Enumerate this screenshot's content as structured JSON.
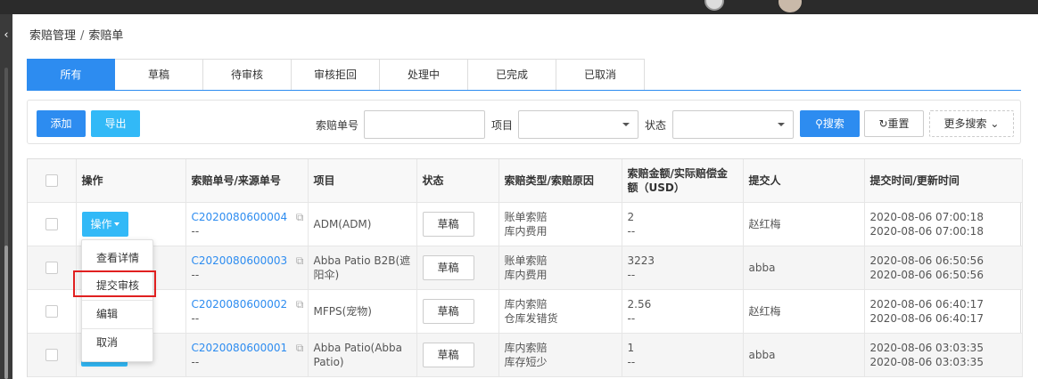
{
  "breadcrumb": {
    "parent": "索赔管理",
    "separator": "/",
    "current": "索赔单"
  },
  "tabs": [
    {
      "label": "所有",
      "active": true
    },
    {
      "label": "草稿",
      "active": false
    },
    {
      "label": "待审核",
      "active": false
    },
    {
      "label": "审核拒回",
      "active": false
    },
    {
      "label": "处理中",
      "active": false
    },
    {
      "label": "已完成",
      "active": false
    },
    {
      "label": "已取消",
      "active": false
    }
  ],
  "toolbar": {
    "add_label": "添加",
    "export_label": "导出",
    "claim_no_label": "索赔单号",
    "claim_no_value": "",
    "project_label": "项目",
    "project_value": "",
    "status_label": "状态",
    "status_value": "",
    "search_label": "搜索",
    "reset_label": "重置",
    "more_label": "更多搜索"
  },
  "table": {
    "headers": [
      "",
      "操作",
      "索赔单号/来源单号",
      "项目",
      "状态",
      "索赔类型/索赔原因",
      "索赔金额/实际赔偿金额（USD）",
      "提交人",
      "提交时间/更新时间"
    ],
    "rows": [
      {
        "claim_no": "C2020080600004",
        "source_no": "--",
        "project": "ADM(ADM)",
        "status": "草稿",
        "type": "账单索赔",
        "reason": "库内费用",
        "amount": "2",
        "actual": "--",
        "submitter": "赵红梅",
        "created": "2020-08-06 07:00:18",
        "updated": "2020-08-06 07:00:18"
      },
      {
        "claim_no": "C2020080600003",
        "source_no": "--",
        "project": "Abba Patio B2B(遮阳伞)",
        "status": "草稿",
        "type": "账单索赔",
        "reason": "库内费用",
        "amount": "3223",
        "actual": "--",
        "submitter": "abba",
        "created": "2020-08-06 06:50:56",
        "updated": "2020-08-06 06:50:56"
      },
      {
        "claim_no": "C2020080600002",
        "source_no": "--",
        "project": "MFPS(宠物)",
        "status": "草稿",
        "type": "库内索赔",
        "reason": "仓库发错货",
        "amount": "2.56",
        "actual": "--",
        "submitter": "赵红梅",
        "created": "2020-08-06 06:40:17",
        "updated": "2020-08-06 06:40:17"
      },
      {
        "claim_no": "C2020080600001",
        "source_no": "--",
        "project": "Abba Patio(Abba Patio)",
        "status": "草稿",
        "type": "库内索赔",
        "reason": "库存短少",
        "amount": "1",
        "actual": "--",
        "submitter": "abba",
        "created": "2020-08-06 03:03:35",
        "updated": "2020-08-06 03:03:35"
      }
    ]
  },
  "operation_button": "操作",
  "dropdown": {
    "items": [
      "查看详情",
      "提交审核",
      "编辑",
      "取消"
    ],
    "highlighted": "提交审核"
  },
  "colors": {
    "primary": "#2d8cf0",
    "secondary": "#32b9f7",
    "highlight_border": "#e02020"
  },
  "icons": {
    "search": "search-icon",
    "reset": "refresh-icon",
    "more": "chevron-down-icon",
    "copy": "copy-icon",
    "collapse": "chevron-left-icon"
  }
}
